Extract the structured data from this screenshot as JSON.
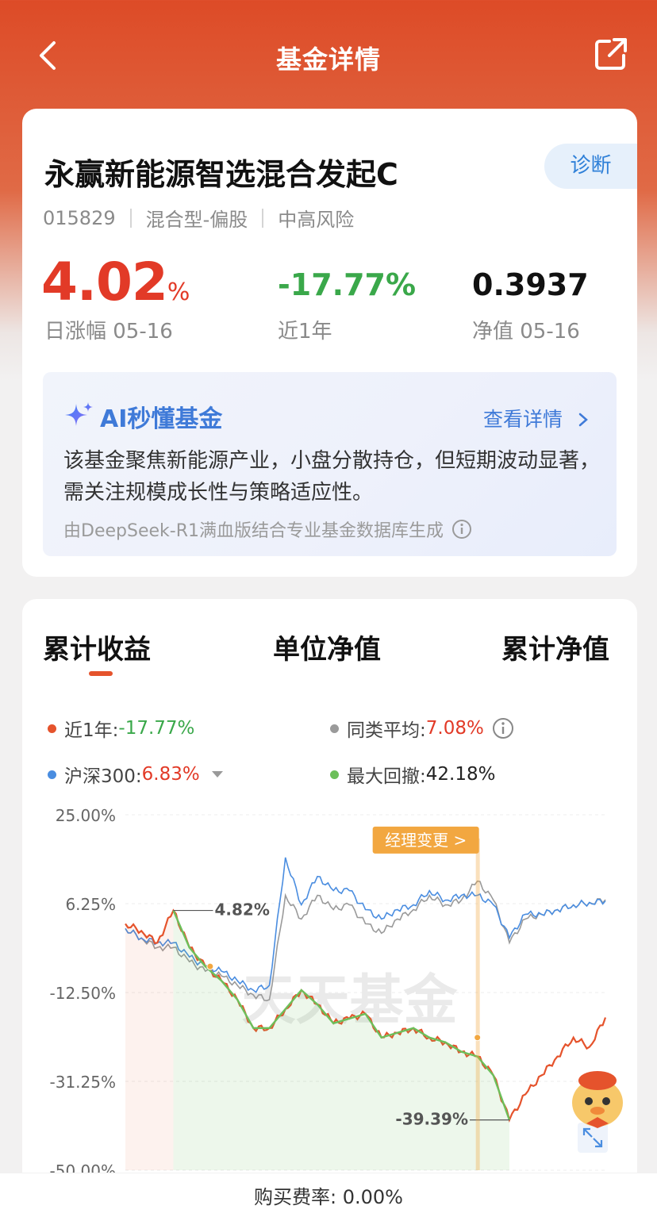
{
  "header": {
    "title": "基金详情"
  },
  "fund": {
    "name": "永赢新能源智选混合发起C",
    "diagnose_label": "诊断",
    "code": "015829",
    "type": "混合型-偏股",
    "risk": "中高风险",
    "daily_change": "4.02",
    "daily_change_unit": "%",
    "daily_change_label": "日涨幅 05-16",
    "year_change": "-17.77%",
    "year_change_label": "近1年",
    "nav": "0.3937",
    "nav_label": "净值 05-16"
  },
  "ai": {
    "title": "AI秒懂基金",
    "more_label": "查看详情",
    "summary": "该基金聚焦新能源产业，小盘分散持仓，但短期波动显著，需关注规模成长性与策略适应性。",
    "source": "由DeepSeek-R1满血版结合专业基金数据库生成"
  },
  "tabs": [
    "累计收益",
    "单位净值",
    "累计净值"
  ],
  "legend": {
    "near_year": {
      "label": "近1年:",
      "value": "-17.77%"
    },
    "peer_avg": {
      "label": "同类平均:",
      "value": "7.08%"
    },
    "hs300": {
      "label": "沪深300:",
      "value": "6.83%"
    },
    "max_drawdown": {
      "label": "最大回撤:",
      "value": "42.18%"
    }
  },
  "chart_labels": {
    "peak": "4.82%",
    "trough": "-39.39%",
    "manager_change": "经理变更 >",
    "watermark": "天天基金"
  },
  "colors": {
    "fund": "#e5532c",
    "peer": "#9a9a9a",
    "hs300": "#4a8de0",
    "drawdown": "#6cbf5a",
    "manager": "#f2a740",
    "accent": "#dd4b27"
  },
  "chart_data": {
    "type": "line",
    "title": "",
    "ylabel": "",
    "ylim": [
      -50,
      25
    ],
    "yticks": [
      "25.00%",
      "6.25%",
      "-12.50%",
      "-31.25%",
      "-50.00%"
    ],
    "series": [
      {
        "name": "近1年",
        "values": [
          2.0,
          0.5,
          -2.0,
          4.82,
          -3.0,
          -7.0,
          -10.0,
          -14.0,
          -20.0,
          -20.0,
          -16.0,
          -12.0,
          -15.0,
          -19.0,
          -18.0,
          -17.0,
          -22.0,
          -21.0,
          -20.0,
          -22.0,
          -23.0,
          -25.0,
          -26.0,
          -30.0,
          -39.39,
          -34.0,
          -30.0,
          -26.0,
          -22.0,
          -24.0,
          -17.77
        ]
      },
      {
        "name": "同类平均",
        "values": [
          1.0,
          -1.0,
          -3.0,
          -3.0,
          -6.0,
          -8.0,
          -9.0,
          -11.0,
          -13.0,
          -14.0,
          8.0,
          3.0,
          8.0,
          5.0,
          6.0,
          2.0,
          0.0,
          3.0,
          5.0,
          8.0,
          6.0,
          7.0,
          11.0,
          7.0,
          -2.0,
          3.0,
          4.0,
          5.0,
          6.0,
          6.5,
          7.08
        ]
      },
      {
        "name": "沪深300",
        "values": [
          1.0,
          -1.0,
          -2.0,
          -2.0,
          -5.0,
          -7.0,
          -8.0,
          -10.0,
          -12.0,
          -11.0,
          16.0,
          6.0,
          12.0,
          9.0,
          9.0,
          5.0,
          3.0,
          5.0,
          6.0,
          9.0,
          7.0,
          8.0,
          8.0,
          6.0,
          -1.0,
          4.0,
          4.0,
          5.0,
          6.0,
          6.5,
          6.83
        ]
      },
      {
        "name": "最大回撤",
        "values": [
          42.18
        ]
      }
    ],
    "annotations": [
      "4.82%",
      "-39.39%",
      "经理变更 >"
    ]
  },
  "footer": {
    "fee": "购买费率: 0.00%"
  }
}
